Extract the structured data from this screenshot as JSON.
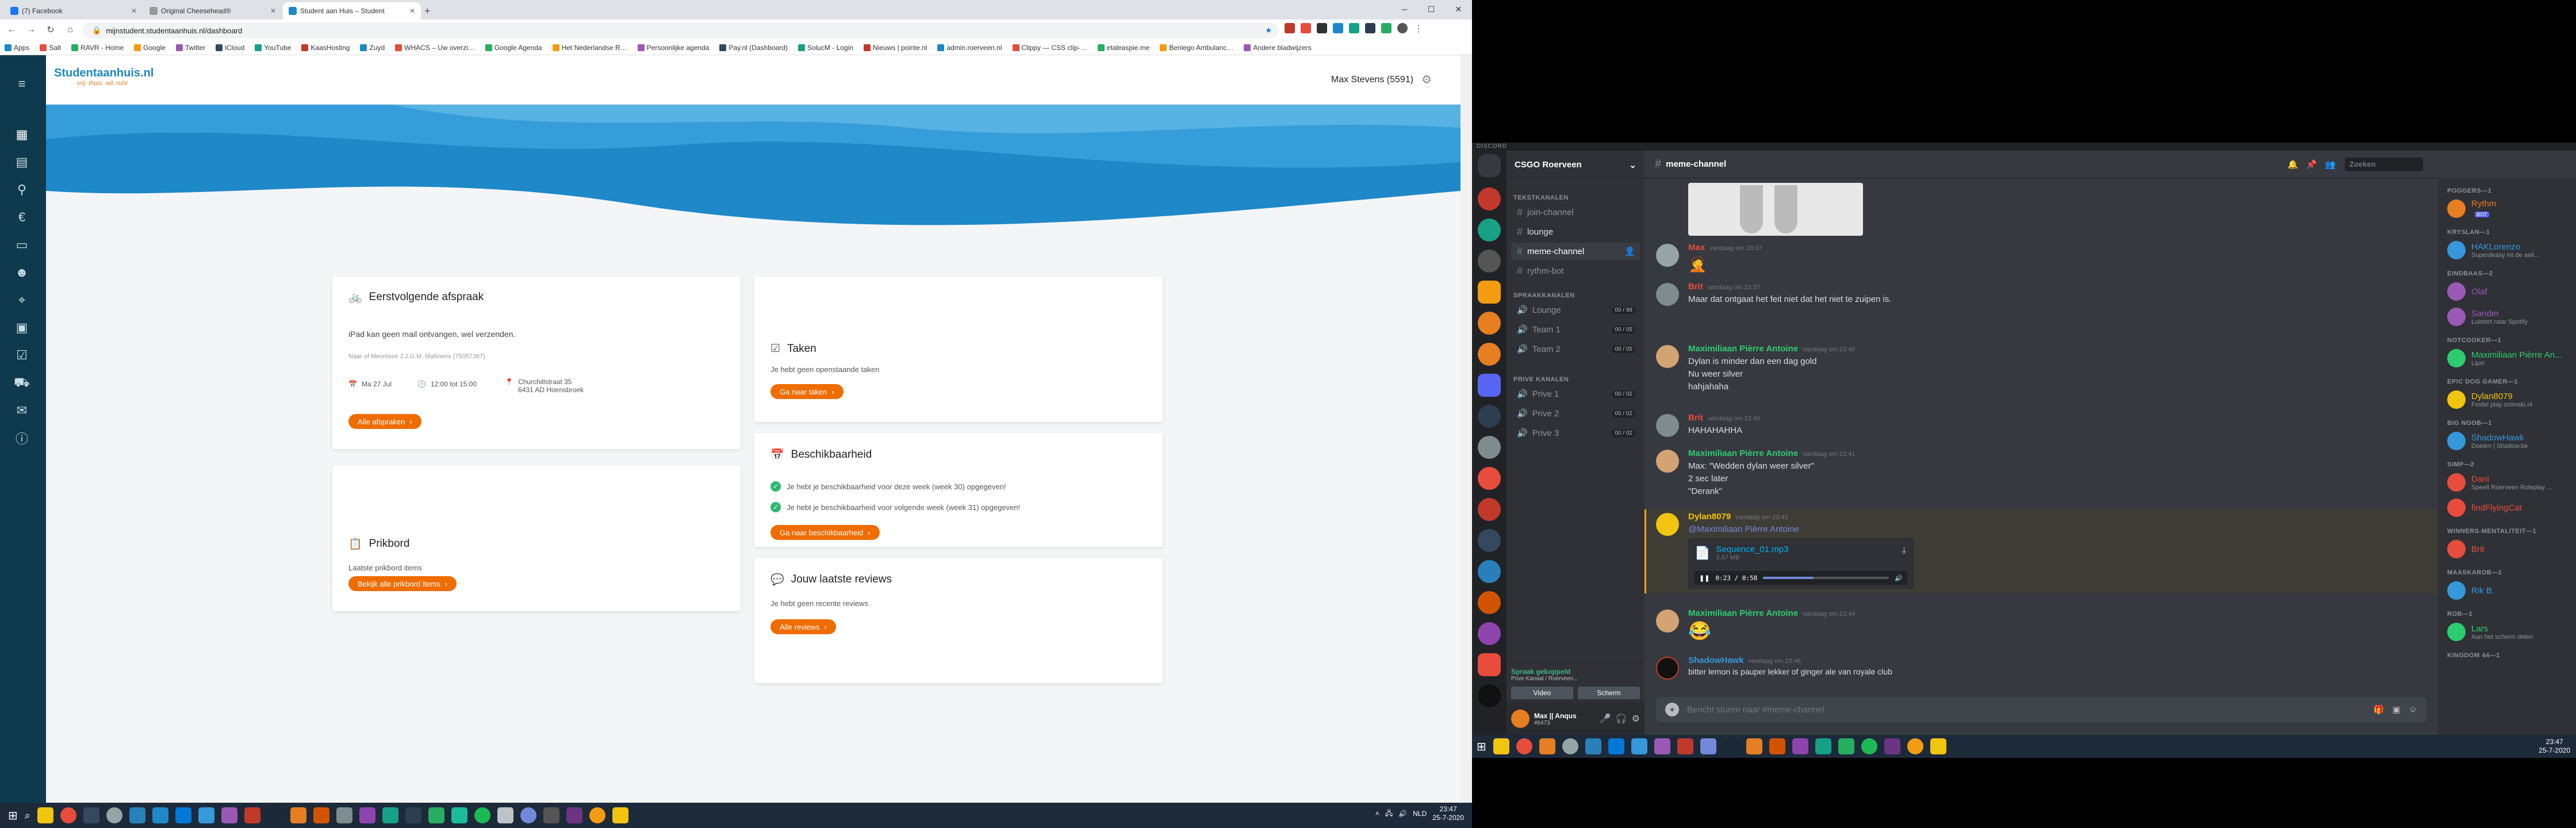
{
  "chrome": {
    "tabs": [
      {
        "title": "(7) Facebook",
        "color": "#1877f2"
      },
      {
        "title": "Original Cheesehead®",
        "color": "#999999"
      },
      {
        "title": "Student aan Huis – Student",
        "color": "#1e88c8"
      }
    ],
    "new_tab": "+",
    "url": "mijnstudent.studentaanhuis.nl/dashboard",
    "bookmarks": [
      "Apps",
      "Salt",
      "RAVR - Home",
      "Google",
      "Twitter",
      "iCloud",
      "YouTube",
      "KaasHosting",
      "Zuyd",
      "WHACS – Uw overzi…",
      "Google Agenda",
      "Het Nederlandse R…",
      "Persoonlijke agenda",
      "Pay.nl (Dashboard)",
      "SolucM - Login",
      "Nieuws | pointe.nl",
      "admin.roerveen.nl",
      "Clippy — CSS clip-…",
      "etaleaspie.me",
      "Benlego Ambulanc…",
      "Andere bladwijzers"
    ]
  },
  "site": {
    "logo_text": "Studentaanhuis.nl",
    "logo_tagline": "vrij. thuis. wil. ruht",
    "user_name": "Max Stevens (5591)",
    "nav_icons": [
      "menu-icon",
      "dashboard-icon",
      "appointments-icon",
      "bike-icon",
      "euro-icon",
      "tasks-icon",
      "profile-icon",
      "location-icon",
      "calendar-icon",
      "checklist-icon",
      "cart-icon",
      "chat-icon",
      "info-icon"
    ]
  },
  "cards": {
    "afspraak": {
      "title": "Eerstvolgende afspraak",
      "desc": "iPad kan geen mail ontvangen, wel verzenden.",
      "meta": "Naar of Mennisse J.J.G.M. Mahnens (75057367)",
      "date": "Ma 27 Jul",
      "time": "12:00 tot 15:00",
      "address1": "Churchillstraat 35",
      "address2": "6431 AD Hoensbroek",
      "button": "Alle afspraken"
    },
    "prikbord": {
      "title": "Prikbord",
      "desc": "Laatste prikbord items",
      "button": "Bekijk alle prikbord items"
    },
    "taken": {
      "title": "Taken",
      "desc": "Je hebt geen openstaande taken",
      "button": "Ga naar taken"
    },
    "beschikbaarheid": {
      "title": "Beschikbaarheid",
      "item1": "Je hebt je beschikbaarheid voor deze week (week 30) opgegeven!",
      "item2": "Je hebt je beschikbaarheid voor volgende week (week 31) opgegeven!",
      "button": "Ga naar beschikbaarheid"
    },
    "reviews": {
      "title": "Jouw laatste reviews",
      "desc": "Je hebt geen recente reviews",
      "button": "Alle reviews"
    }
  },
  "taskbar_left": {
    "time": "23:47",
    "date": "25-7-2020",
    "lang": "NLD"
  },
  "discord": {
    "app_title": "DISCORD",
    "guild": "CSGO Roerveen",
    "categories": {
      "text": "TEKSTKANALEN",
      "voice": "SPRAAKKANALEN",
      "prive": "PRIVE KANALEN"
    },
    "text_channels": [
      "join-channel",
      "lounge",
      "meme-channel",
      "rythm-bot"
    ],
    "voice_channels": [
      {
        "name": "Lounge",
        "count": "00 / 99"
      },
      {
        "name": "Team 1",
        "count": "00 / 05"
      },
      {
        "name": "Team 2",
        "count": "00 / 05"
      }
    ],
    "prive_channels": [
      {
        "name": "Prive 1",
        "count": "00 / 02"
      },
      {
        "name": "Prive 2",
        "count": "00 / 02"
      },
      {
        "name": "Prive 3",
        "count": "00 / 02"
      }
    ],
    "voice_status": "Spraak gekoppeld",
    "voice_location": "Prive Kanaal / Roerveen...",
    "video_btn": "Video",
    "screen_btn": "Scherm",
    "user_name": "Max || Anqus",
    "user_tag": "#6473",
    "current_channel": "meme-channel",
    "search": "Zoeken",
    "input_placeholder": "Bericht sturen naar #meme-channel",
    "messages": [
      {
        "author": "Max",
        "color": "#e74c3c",
        "time": "vandaag om 23:37",
        "lines": [
          "🤦"
        ]
      },
      {
        "author": "Brit",
        "color": "#e74c3c",
        "time": "vandaag om 23:37",
        "lines": [
          "Maar dat ontgaat het feit niet dat het niet te zuipen is."
        ]
      },
      {
        "author": "Maximiliaan Pièrre Antoine",
        "color": "#2ecc71",
        "time": "vandaag om 23:40",
        "lines": [
          "Dylan is minder dan een dag gold",
          "Nu weer silver",
          "hahjahaha"
        ]
      },
      {
        "author": "Brit",
        "color": "#e74c3c",
        "time": "vandaag om 23:40",
        "lines": [
          "HAHAHAHHA"
        ]
      },
      {
        "author": "Maximiliaan Pièrre Antoine",
        "color": "#2ecc71",
        "time": "vandaag om 23:41",
        "lines": [
          "Max: \"Wedden dylan weer silver\"",
          "2 sec later",
          "\"Derank\""
        ]
      },
      {
        "author": "Dylan8079",
        "color": "#f1c40f",
        "time": "vandaag om 23:43",
        "lines": [
          "@Maximiliaan Pièrre Antoine"
        ]
      },
      {
        "author": "Maximiliaan Pièrre Antoine",
        "color": "#2ecc71",
        "time": "vandaag om 23:44",
        "lines": [
          "😂"
        ]
      },
      {
        "author": "ShadowHawk",
        "color": "#3498db",
        "time": "vandaag om 23:46",
        "lines": [
          "bitter lemon is pauper lekker of ginger ale van royale club"
        ]
      }
    ],
    "attachment": {
      "file": "Sequence_01.mp3",
      "size": "3.67 MB",
      "progress": "0:23 / 0:58",
      "played_fraction": 0.4
    },
    "members": [
      {
        "group": "POGGERS—1",
        "items": [
          {
            "name": "Rythm",
            "color": "#e67e22",
            "status": "",
            "badge": "BOT"
          }
        ]
      },
      {
        "group": "KRYSLAN—1",
        "items": [
          {
            "name": "HAKLorenzo",
            "color": "#3498db",
            "status": "Superdeasy int de aeli..."
          }
        ]
      },
      {
        "group": "EINDBAAS—2",
        "items": [
          {
            "name": "Olaf",
            "color": "#9b59b6",
            "status": ""
          },
          {
            "name": "Sander",
            "color": "#9b59b6",
            "status": "Luistert naar Spotify"
          }
        ]
      },
      {
        "group": "NOTCOOKER—1",
        "items": [
          {
            "name": "Maximiliaan Pièrre An...",
            "color": "#2ecc71",
            "status": "Lips!"
          }
        ]
      },
      {
        "group": "EPIC DOG GAMER—1",
        "items": [
          {
            "name": "Dylan8079",
            "color": "#f1c40f",
            "status": "Fosfel play oroinski.nl"
          }
        ]
      },
      {
        "group": "BIG NOOB—1",
        "items": [
          {
            "name": "ShadowHawk",
            "color": "#3498db",
            "status": "Doelen | Shadow.be"
          }
        ]
      },
      {
        "group": "SIMP—2",
        "items": [
          {
            "name": "Dani",
            "color": "#e74c3c",
            "status": "Speelt Roerveen Roleplay ..."
          },
          {
            "name": "findFlyingCat",
            "color": "#e74c3c",
            "status": ""
          }
        ]
      },
      {
        "group": "WINNERS-MENTALITEIT—1",
        "items": [
          {
            "name": "Brit",
            "color": "#e74c3c",
            "status": ""
          }
        ]
      },
      {
        "group": "MAASKAROB—1",
        "items": [
          {
            "name": "Rik B.",
            "color": "#3498db",
            "status": ""
          }
        ]
      },
      {
        "group": "ROB—1",
        "items": [
          {
            "name": "Lars",
            "color": "#2ecc71",
            "status": "Aan het scherm delen"
          }
        ]
      },
      {
        "group": "KINGDOM 44—1",
        "items": []
      }
    ]
  },
  "taskbar_right": {
    "time": "23:47",
    "date": "25-7-2020"
  }
}
